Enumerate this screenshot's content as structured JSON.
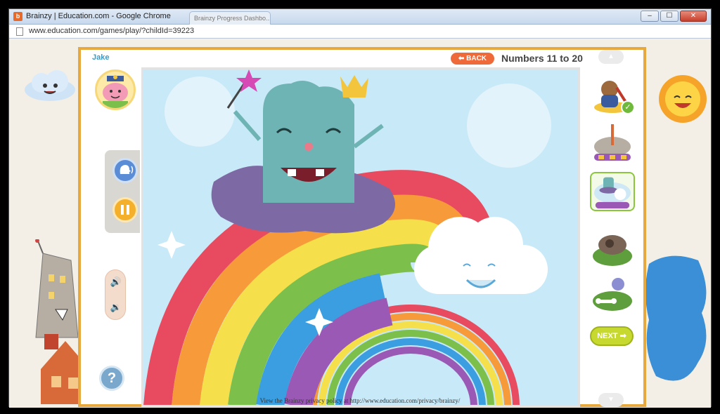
{
  "window": {
    "title": "Brainzy | Education.com - Google Chrome",
    "tab_label": "Brainzy Progress Dashbo...",
    "min_label": "–",
    "max_label": "☐",
    "close_label": "✕"
  },
  "address_bar": {
    "url": "www.education.com/games/play/?childId=39223"
  },
  "game": {
    "player_name": "Jake",
    "back_label": "BACK",
    "title": "Numbers 11 to 20",
    "next_label": "NEXT",
    "help_label": "?"
  },
  "thumbnails": [
    {
      "name": "bear-violin",
      "completed": true
    },
    {
      "name": "crane-scene",
      "completed": false
    },
    {
      "name": "rainbow-monster",
      "completed": false,
      "active": true
    },
    {
      "name": "gorilla-cave",
      "completed": false
    },
    {
      "name": "dog-bone",
      "completed": false
    }
  ],
  "footer": {
    "text": "View the Brainzy privacy policy at http://www.education.com/privacy/brainzy/"
  },
  "colors": {
    "frame": "#e7a83d",
    "back": "#ef6a3a",
    "next": "#c7d82f",
    "accent": "#3f9ac1"
  }
}
